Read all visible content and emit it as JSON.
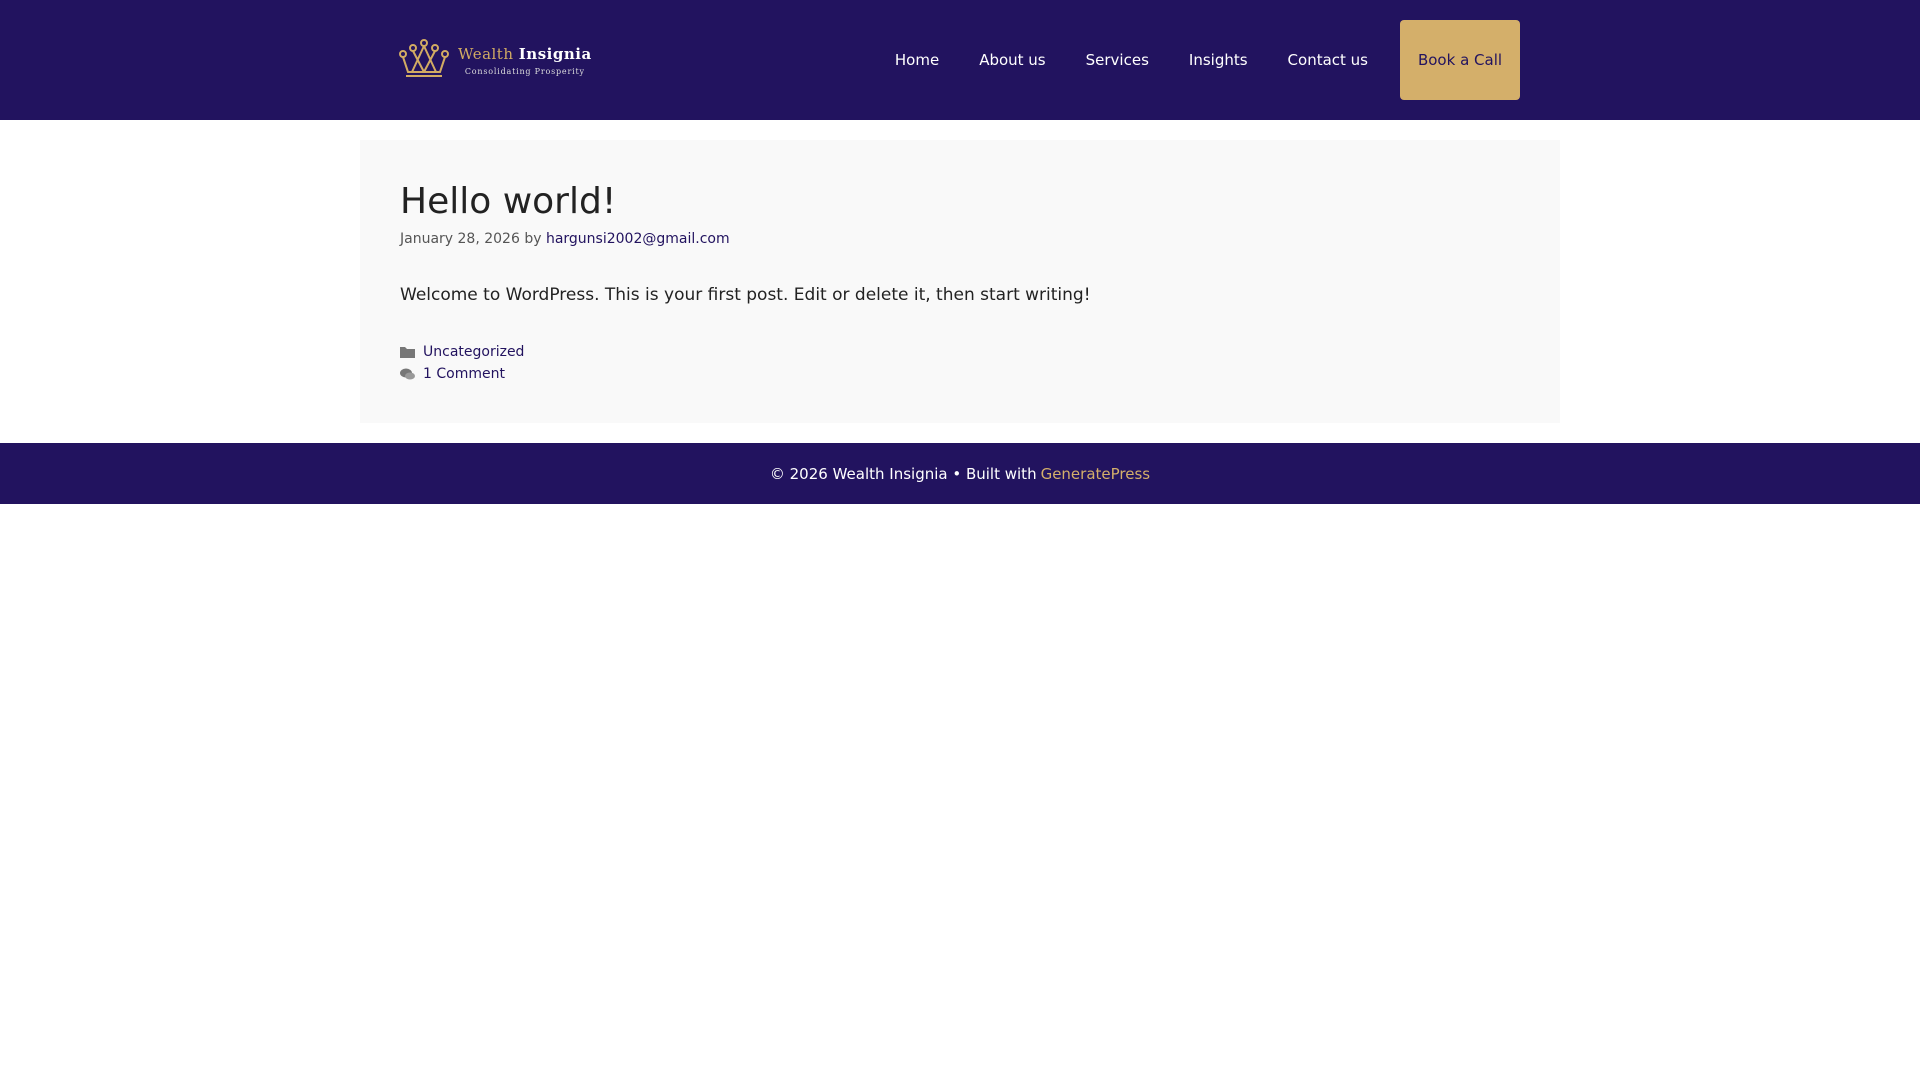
{
  "header": {
    "logo": {
      "brand_first": "Wealth",
      "brand_second": "Insignia",
      "tagline": "Consolidating Prosperity"
    },
    "nav": [
      "Home",
      "About us",
      "Services",
      "Insights",
      "Contact us"
    ],
    "cta": "Book a Call"
  },
  "post": {
    "title": "Hello world!",
    "date": "January 28, 2026",
    "by": "by",
    "author": "hargunsi2002@gmail.com",
    "body": "Welcome to WordPress. This is your first post. Edit or delete it, then start writing!",
    "category": "Uncategorized",
    "comments": "1 Comment"
  },
  "footer": {
    "copyright": "© 2026 Wealth Insignia • Built with",
    "link": "GeneratePress"
  },
  "colors": {
    "brand": "#22135f",
    "accent": "#d4af6a"
  }
}
